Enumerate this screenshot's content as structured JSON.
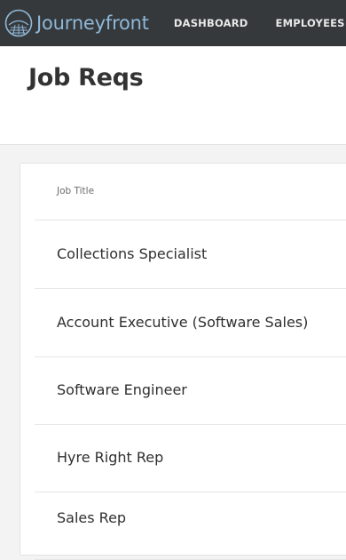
{
  "app": {
    "brand": "Journeyfront",
    "nav": [
      "DASHBOARD",
      "EMPLOYEES"
    ]
  },
  "page": {
    "title": "Job Reqs"
  },
  "table": {
    "column_header": "Job Title",
    "rows": [
      "Collections Specialist",
      "Account Executive (Software Sales)",
      "Software Engineer",
      "Hyre Right Rep",
      "Sales Rep"
    ]
  },
  "icons": {
    "logo": "journeyfront-logo-icon"
  },
  "colors": {
    "topbar": "#35393b",
    "brand": "#8fb8d9",
    "background": "#f3f3f3"
  }
}
